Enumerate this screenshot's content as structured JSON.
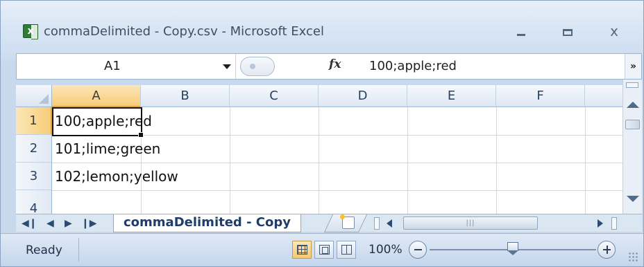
{
  "window": {
    "title": "commaDelimited - Copy.csv - Microsoft Excel",
    "app_icon": "excel-icon",
    "close_glyph": "x"
  },
  "formula_bar": {
    "name_box": "A1",
    "fx_label": "fx",
    "formula": "100;apple;red"
  },
  "sheet": {
    "columns": [
      "A",
      "B",
      "C",
      "D",
      "E",
      "F"
    ],
    "rows": [
      "1",
      "2",
      "3",
      "4"
    ],
    "active_cell": "A1",
    "cells": [
      {
        "row": "1",
        "col": "A",
        "value": "100;apple;red"
      },
      {
        "row": "2",
        "col": "A",
        "value": "101;lime;green"
      },
      {
        "row": "3",
        "col": "A",
        "value": "102;lemon;yellow"
      }
    ]
  },
  "tabs": {
    "sheet_tab": "commaDelimited - Copy"
  },
  "status_bar": {
    "status": "Ready",
    "zoom": "100%"
  },
  "colors": {
    "accent_active_header": "#f8cd79",
    "chrome": "#c8d9ee",
    "tab_text": "#1f3d6b"
  }
}
